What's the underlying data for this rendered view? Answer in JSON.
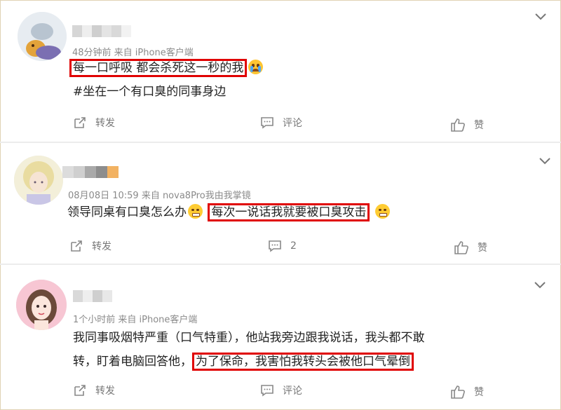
{
  "posts": [
    {
      "meta": "48分钟前  来自 iPhone客户端",
      "line1_highlight": "每一口呼吸 都会杀死这一秒的我",
      "line2": "#坐在一个有口臭的同事身边",
      "repost_label": "转发",
      "comment_label": "评论",
      "like_label": "赞",
      "emoji": "crying-emoji"
    },
    {
      "meta": "08月08日 10:59  来自 nova8Pro我由我掌镜",
      "line1_pre": "领导同桌有口臭怎么办",
      "line1_highlight": "每次一说话我就要被口臭攻击",
      "repost_label": "转发",
      "comment_count": "2",
      "like_label": "赞",
      "emoji": "awkward-smile-emoji"
    },
    {
      "meta": "1个小时前  来自 iPhone客户端",
      "line1": "我同事吸烟特严重（口气特重），他站我旁边跟我说话，我头都不敢",
      "line2_pre": "转，盯着电脑回答他，",
      "line2_highlight": "为了保命，我害怕我转头会被他口气晕倒",
      "repost_label": "转发",
      "comment_label": "评论",
      "like_label": "赞"
    }
  ],
  "colors": {
    "highlight_border": "#e00000",
    "meta_text": "#8a8a8a",
    "body_text": "#222222",
    "frame_border": "#e0d3b4"
  }
}
